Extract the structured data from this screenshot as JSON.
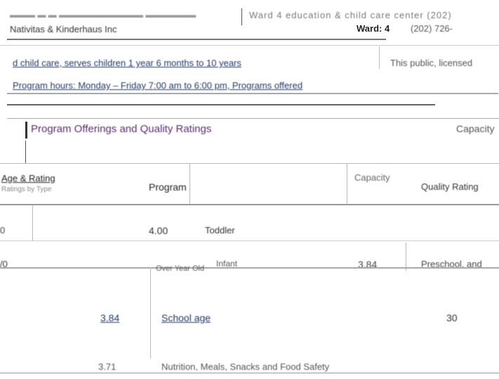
{
  "header": {
    "org_name": "Nativitas & Kinderhaus Inc",
    "ward": "Ward: 4",
    "right_snippet": "(202) 726-",
    "top_right_text": "Ward 4 education & child care center (202)"
  },
  "description": {
    "line1": "d child care, serves children 1 year 6 months to 10 years",
    "line1_right": "This public, licensed",
    "line2": "Program hours: Monday – Friday 7:00 am to 6:00 pm, Programs offered"
  },
  "section": {
    "title": "Program Offerings and Quality Ratings",
    "right_label": "Capacity"
  },
  "table": {
    "col_left_header": "Age & Rating",
    "col_left_sub": "Ratings by Type",
    "col_program": "Program",
    "col_capacity": "Capacity",
    "col_quality": "Quality Rating",
    "rows": [
      {
        "left": "0",
        "score": "4.00",
        "program": "Toddler",
        "capacity": "",
        "right": ""
      },
      {
        "left": "/0",
        "score": "",
        "program": "Infant",
        "capacity": "3.84",
        "right": "Preschool, and"
      },
      {
        "left": "",
        "score": "",
        "program": "Over Year Old",
        "capacity": "",
        "right": ""
      },
      {
        "left": "",
        "score": "3.84",
        "program": "School age",
        "capacity": "30",
        "right": ""
      },
      {
        "left": "",
        "score": "3.71",
        "program": "Nutrition, Meals, Snacks and Food Safety",
        "capacity": "",
        "right": ""
      }
    ]
  }
}
